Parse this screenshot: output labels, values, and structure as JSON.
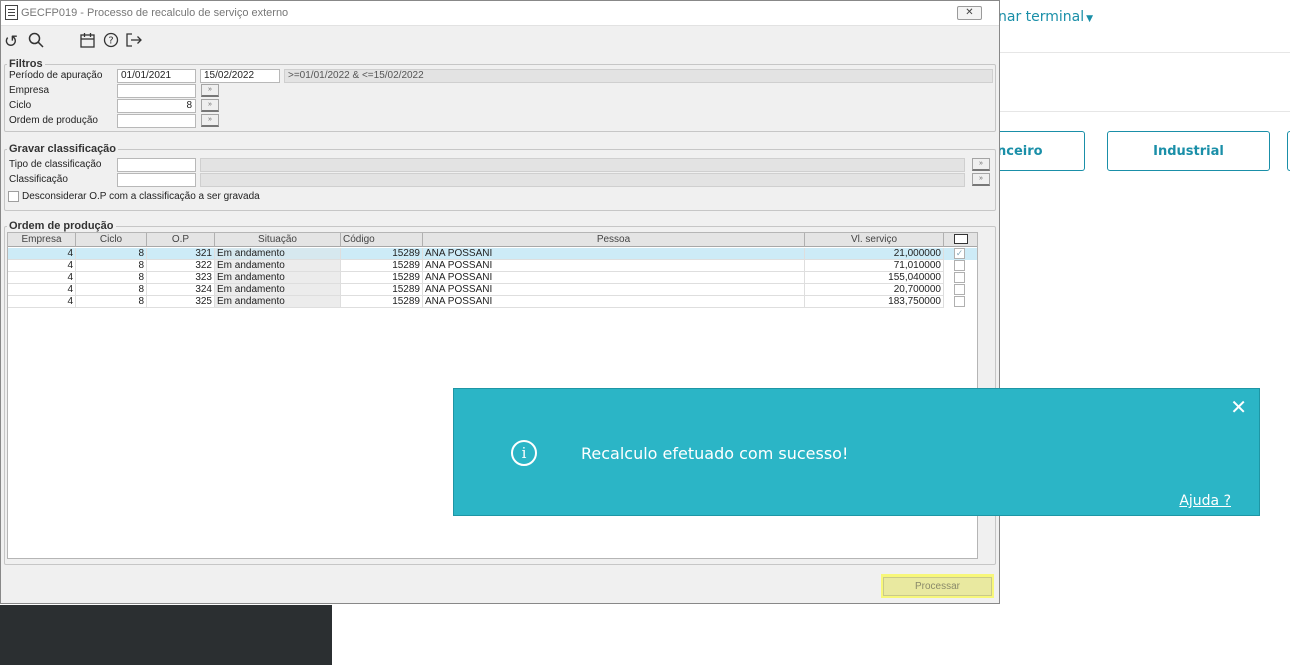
{
  "background_page": {
    "terminal_link": "nar terminal",
    "buttons": [
      "nceiro",
      "Industrial"
    ]
  },
  "window": {
    "title": "GECFP019 - Processo de recalculo de serviço externo",
    "close_glyph": "✕",
    "toolbar_icons": [
      "undo-icon",
      "search-icon",
      "calendar-icon",
      "help-icon",
      "exit-icon"
    ]
  },
  "filtros": {
    "legend": "Filtros",
    "periodo_label": "Período de apuração",
    "periodo_inicio": "01/01/2021",
    "periodo_fim": "15/02/2022",
    "periodo_expr": ">=01/01/2022 & <=15/02/2022",
    "empresa_label": "Empresa",
    "empresa_value": "",
    "ciclo_label": "Ciclo",
    "ciclo_value": "8",
    "op_label": "Ordem de produção",
    "op_value": ""
  },
  "gravar": {
    "legend": "Gravar classificação",
    "tipo_label": "Tipo de classificação",
    "classificacao_label": "Classificação",
    "desconsiderar_label": "Desconsiderar O.P com a classificação a ser gravada"
  },
  "ordem": {
    "legend": "Ordem de produção",
    "columns": [
      "Empresa",
      "Ciclo",
      "O.P",
      "Situação",
      "Código",
      "Pessoa",
      "Vl. serviço"
    ],
    "rows": [
      {
        "empresa": "4",
        "ciclo": "8",
        "op": "321",
        "situacao": "Em andamento",
        "codigo": "15289",
        "pessoa": "ANA POSSANI",
        "valor": "21,000000",
        "checked": true
      },
      {
        "empresa": "4",
        "ciclo": "8",
        "op": "322",
        "situacao": "Em andamento",
        "codigo": "15289",
        "pessoa": "ANA POSSANI",
        "valor": "71,010000",
        "checked": false
      },
      {
        "empresa": "4",
        "ciclo": "8",
        "op": "323",
        "situacao": "Em andamento",
        "codigo": "15289",
        "pessoa": "ANA POSSANI",
        "valor": "155,040000",
        "checked": false
      },
      {
        "empresa": "4",
        "ciclo": "8",
        "op": "324",
        "situacao": "Em andamento",
        "codigo": "15289",
        "pessoa": "ANA POSSANI",
        "valor": "20,700000",
        "checked": false
      },
      {
        "empresa": "4",
        "ciclo": "8",
        "op": "325",
        "situacao": "Em andamento",
        "codigo": "15289",
        "pessoa": "ANA POSSANI",
        "valor": "183,750000",
        "checked": false
      }
    ]
  },
  "processar_label": "Processar",
  "toast": {
    "message": "Recalculo efetuado com sucesso!",
    "help_link": "Ajuda ?",
    "close_glyph": "✕",
    "info_glyph": "i"
  },
  "colors": {
    "accent": "#1a8fa8",
    "toast_bg": "#2bb5c6",
    "highlight": "#f7f77a",
    "selected_row": "#cdebf7"
  }
}
